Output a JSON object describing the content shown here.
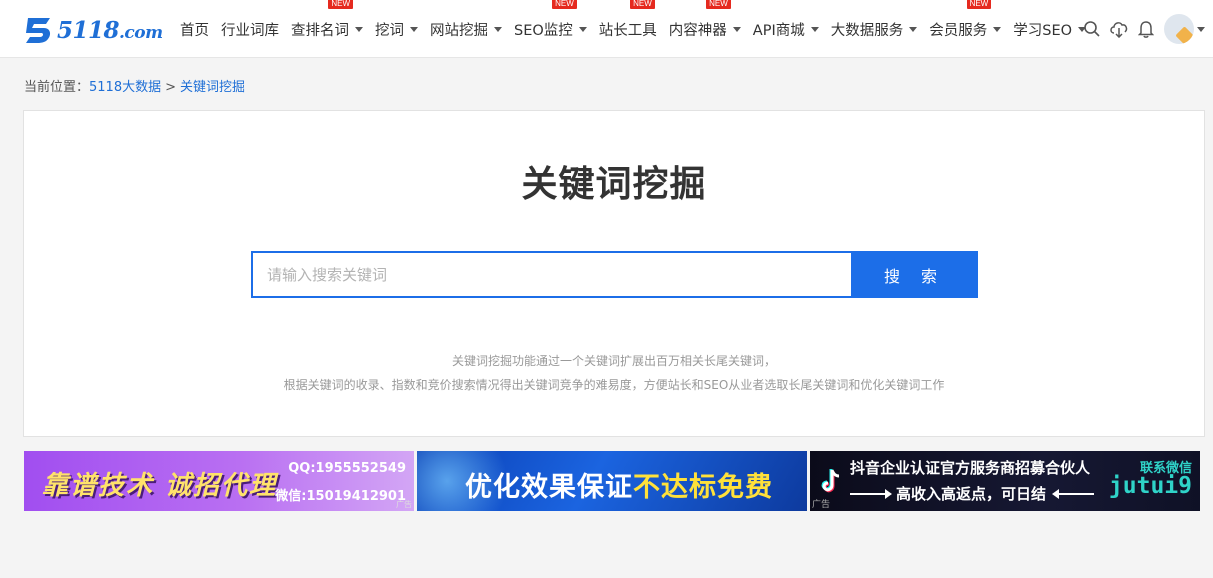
{
  "logo": {
    "brand": "5118",
    "suffix": ".com"
  },
  "nav": {
    "items": [
      {
        "label": "首页",
        "caret": false,
        "badge": ""
      },
      {
        "label": "行业词库",
        "caret": false,
        "badge": ""
      },
      {
        "label": "查排名词",
        "caret": true,
        "badge": "NEW"
      },
      {
        "label": "挖词",
        "caret": true,
        "badge": ""
      },
      {
        "label": "网站挖掘",
        "caret": true,
        "badge": ""
      },
      {
        "label": "SEO监控",
        "caret": true,
        "badge": "NEW"
      },
      {
        "label": "站长工具",
        "caret": false,
        "badge": "NEW"
      },
      {
        "label": "内容神器",
        "caret": true,
        "badge": "NEW"
      },
      {
        "label": "API商城",
        "caret": true,
        "badge": ""
      },
      {
        "label": "大数据服务",
        "caret": true,
        "badge": ""
      },
      {
        "label": "会员服务",
        "caret": true,
        "badge": "NEW"
      },
      {
        "label": "学习SEO",
        "caret": true,
        "badge": ""
      }
    ]
  },
  "header_icons": [
    "search-icon",
    "cloud-download-icon",
    "bell-icon",
    "avatar"
  ],
  "breadcrumb": {
    "prefix": "当前位置：",
    "links": [
      "5118大数据",
      "关键词挖掘"
    ],
    "separator": ">"
  },
  "main": {
    "title": "关键词挖掘",
    "search": {
      "placeholder": "请输入搜索关键词",
      "value": "",
      "button_label": "搜 索"
    },
    "description_line1": "关键词挖掘功能通过一个关键词扩展出百万相关长尾关键词，",
    "description_line2": "根据关键词的收录、指数和竞价搜索情况得出关键词竞争的难易度，方便站长和SEO从业者选取长尾关键词和优化关键词工作"
  },
  "banners": {
    "b1": {
      "headline": "靠谱技术 诚招代理",
      "qq": "QQ:1955552549",
      "wechat": "微信:15019412901",
      "ad": "广告"
    },
    "b2": {
      "headline_part1": "优化效果保证",
      "headline_part2": "不达标免费"
    },
    "b3": {
      "line1": "抖音企业认证官方服务商招募合伙人",
      "line2": "高收入高返点，可日结",
      "contact_label": "联系微信",
      "contact_id": "jutui9",
      "ad": "广告"
    }
  },
  "colors": {
    "brand_blue": "#1c6ee8",
    "link_blue": "#1f6fd6",
    "badge_red": "#e52a1f"
  }
}
